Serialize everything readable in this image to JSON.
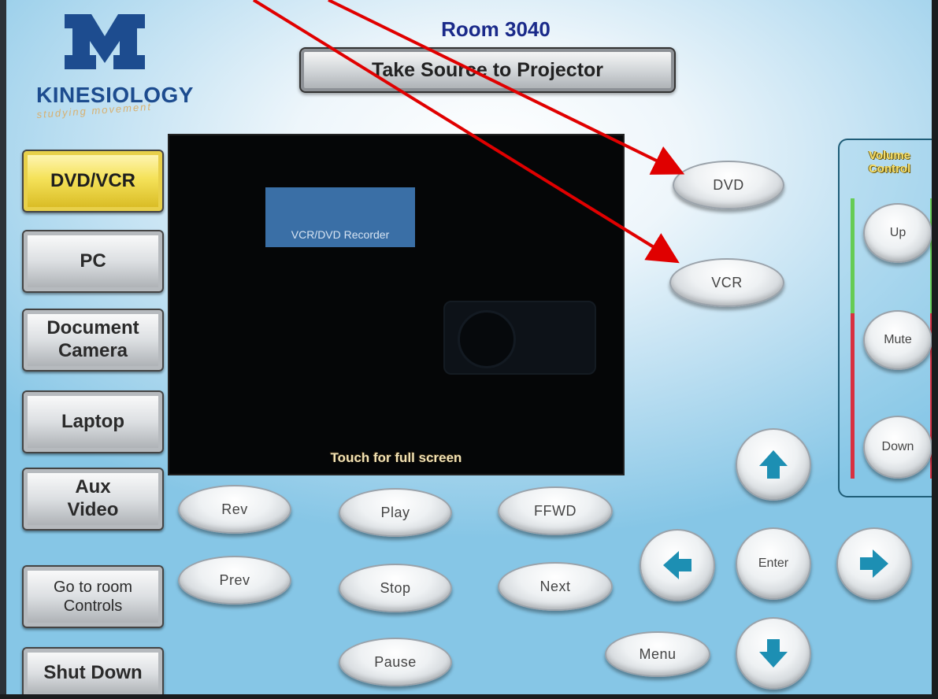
{
  "header": {
    "room_title": "Room 3040",
    "take_source_label": "Take Source to Projector"
  },
  "logo": {
    "name": "KINESIOLOGY",
    "tagline": "studying movement"
  },
  "sources": [
    {
      "label": "DVD/VCR",
      "active": true
    },
    {
      "label": "PC"
    },
    {
      "label": "Document\nCamera"
    },
    {
      "label": "Laptop"
    },
    {
      "label": "Aux\nVideo"
    },
    {
      "label": "Go to room\nControls"
    },
    {
      "label": "Shut Down"
    }
  ],
  "preview": {
    "source_label": "VCR/DVD Recorder",
    "caption": "Touch for full screen"
  },
  "device_select": {
    "dvd_label": "DVD",
    "vcr_label": "VCR"
  },
  "transport": {
    "rev": "Rev",
    "play": "Play",
    "ffwd": "FFWD",
    "prev": "Prev",
    "stop": "Stop",
    "next": "Next",
    "pause": "Pause",
    "menu": "Menu"
  },
  "navigation": {
    "enter": "Enter",
    "up_icon": "arrow-up-icon",
    "down_icon": "arrow-down-icon",
    "left_icon": "arrow-left-icon",
    "right_icon": "arrow-right-icon"
  },
  "volume": {
    "title": "Volume\nControl",
    "up": "Up",
    "mute": "Mute",
    "down": "Down"
  },
  "colors": {
    "active_source": "#f5e25a",
    "arrow_teal": "#1d8fb3",
    "annotation_red": "#e00000",
    "header_blue": "#1a2a8a"
  }
}
